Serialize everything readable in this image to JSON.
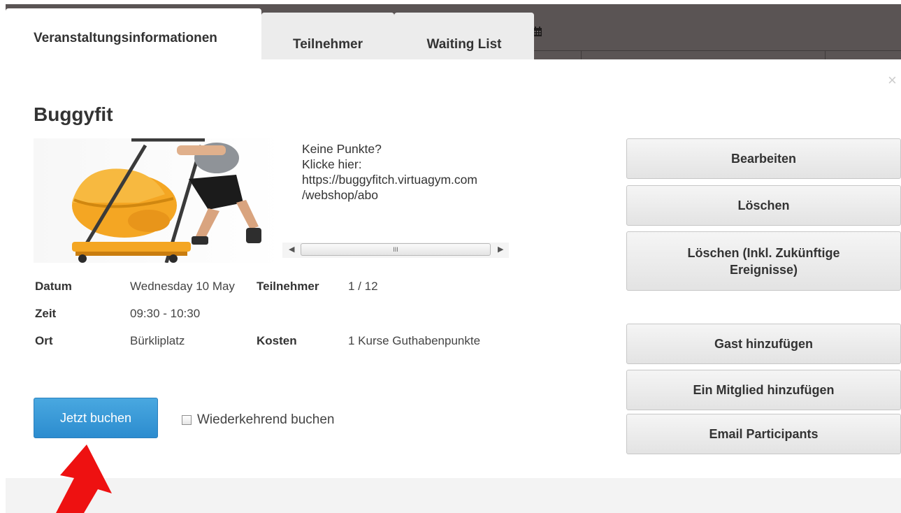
{
  "tabs": [
    {
      "label": "Veranstaltungsinformationen",
      "active": true
    },
    {
      "label": "Teilnehmer",
      "active": false
    },
    {
      "label": "Waiting List",
      "active": false
    }
  ],
  "header": {
    "calendar_icon": "calendar-icon"
  },
  "dialog": {
    "close_label": "×",
    "title": "Buggyfit",
    "description_lines": [
      "Keine Punkte?",
      "Klicke hier:",
      "https://buggyfitch.virtuagym.com",
      "/webshop/abo"
    ],
    "scrollbar_grip": "III"
  },
  "details": {
    "date_label": "Datum",
    "date_value": "Wednesday 10 May",
    "participants_label": "Teilnehmer",
    "participants_value": "1 / 12",
    "time_label": "Zeit",
    "time_value": "09:30 - 10:30",
    "location_label": "Ort",
    "location_value": "Bürkliplatz",
    "cost_label": "Kosten",
    "cost_value": "1 Kurse Guthabenpunkte"
  },
  "actions": {
    "edit": "Bearbeiten",
    "delete": "Löschen",
    "delete_future": "Löschen (Inkl. Zukünftige Ereignisse)",
    "add_guest": "Gast hinzufügen",
    "add_member": "Ein Mitglied hinzufügen",
    "email_participants": "Email Participants"
  },
  "booking": {
    "book_now": "Jetzt buchen",
    "recurring_label": "Wiederkehrend buchen",
    "recurring_checked": false
  },
  "colors": {
    "primary": "#2c8ccf",
    "header_dark": "#5a5454",
    "annotation_arrow": "#ee1111"
  }
}
